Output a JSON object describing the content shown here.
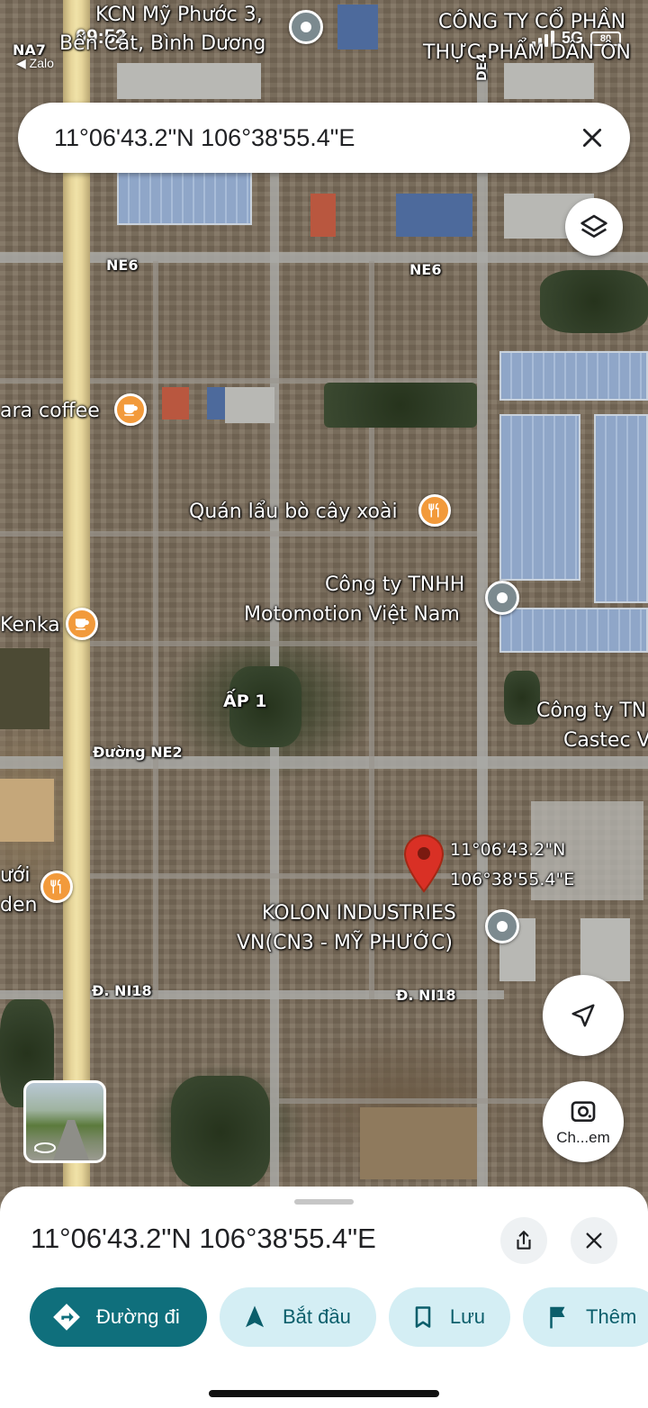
{
  "status_bar": {
    "time": "09:52",
    "back_app": "◀ Zalo",
    "network": "5G",
    "battery": "80"
  },
  "search": {
    "query": "11°06'43.2\"N 106°38'55.4\"E"
  },
  "map": {
    "poi_labels": {
      "kcn": "KCN Mỹ Phước 3,",
      "kcn_sub": "Bến Cát, Bình Dương",
      "cong_ty_co_phan": "CÔNG TY CỔ PHẦN",
      "thuc_pham": "THỰC PHẨM DÂN ÔN",
      "ara_coffee": "ara coffee",
      "quan_lau": "Quán lẩu bò cây xoài",
      "motomotion_1": "Công ty TNHH",
      "motomotion_2": "Motomotion Việt Nam",
      "kenka": "Kenka",
      "ap1": "ẤP 1",
      "castec_1": "Công ty TN",
      "castec_2": "Castec V",
      "nuoi": "ưới",
      "den": "den",
      "kolon_1": "KOLON INDUSTRIES",
      "kolon_2": "VN(CN3 - MỸ PHƯỚC)"
    },
    "road_labels": {
      "na7": "NA7",
      "de4": "DE4",
      "ne6_left": "NE6",
      "ne6_right": "NE6",
      "ne2": "Đường NE2",
      "ni18_left": "Đ. NI18",
      "ni18_right": "Đ. NI18"
    },
    "dropped_pin": {
      "lat": "11°06'43.2\"N",
      "lng": "106°38'55.4\"E"
    },
    "lens_label": "Ch...em"
  },
  "sheet": {
    "title": "11°06'43.2\"N 106°38'55.4\"E",
    "actions": [
      {
        "label": "Đường đi",
        "icon": "directions-icon"
      },
      {
        "label": "Bắt đầu",
        "icon": "navigation-arrow-icon"
      },
      {
        "label": "Lưu",
        "icon": "bookmark-icon"
      },
      {
        "label": "Thêm",
        "icon": "flag-icon"
      }
    ]
  },
  "colors": {
    "primary_chip": "#0f6f7c",
    "tonal_chip": "#d4eef4",
    "pin_red": "#d93025",
    "poi_orange": "#f29a3b"
  }
}
